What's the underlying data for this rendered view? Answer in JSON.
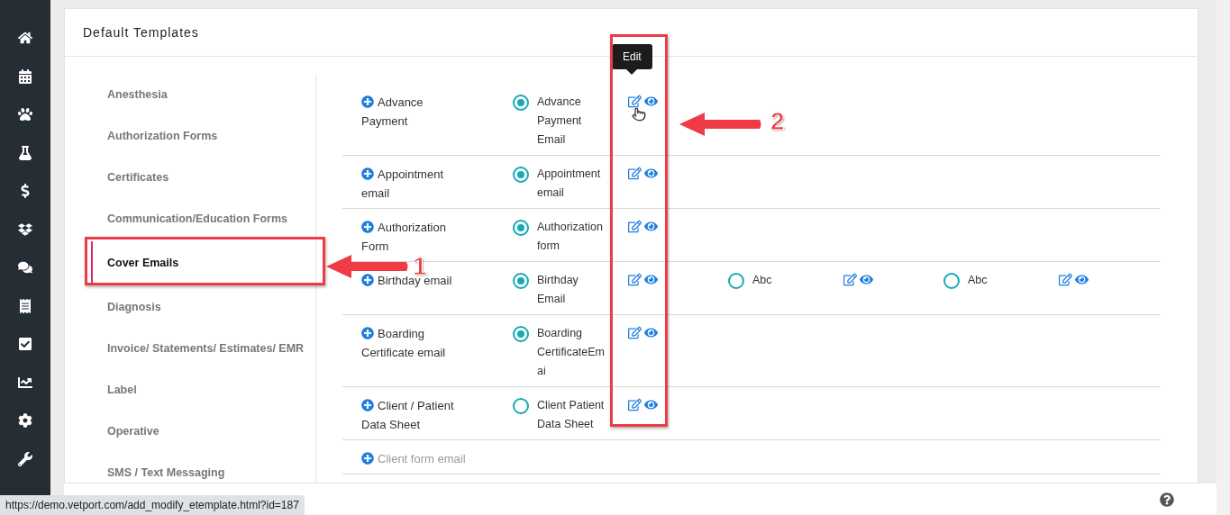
{
  "card": {
    "title": "Default Templates"
  },
  "menu": [
    {
      "label": "Anesthesia",
      "selected": false
    },
    {
      "label": "Authorization Forms",
      "selected": false
    },
    {
      "label": "Certificates",
      "selected": false
    },
    {
      "label": "Communication/Education Forms",
      "selected": false
    },
    {
      "label": "Cover Emails",
      "selected": true
    },
    {
      "label": "Diagnosis",
      "selected": false
    },
    {
      "label": "Invoice/ Statements/ Estimates/ EMR",
      "selected": false
    },
    {
      "label": "Label",
      "selected": false
    },
    {
      "label": "Operative",
      "selected": false
    },
    {
      "label": "SMS / Text Messaging",
      "selected": false
    }
  ],
  "rows": [
    {
      "name": "Advance Payment",
      "has_templates": true,
      "templates": [
        {
          "label": "Advance Payment Email",
          "selected": true
        }
      ]
    },
    {
      "name": "Appointment email",
      "has_templates": true,
      "templates": [
        {
          "label": "Appointment email",
          "selected": true
        }
      ]
    },
    {
      "name": "Authorization Form",
      "has_templates": true,
      "templates": [
        {
          "label": "Authorization form",
          "selected": true
        }
      ]
    },
    {
      "name": "Birthday email",
      "has_templates": true,
      "templates": [
        {
          "label": "Birthday Email",
          "selected": true
        },
        {
          "label": "Abc",
          "selected": false
        },
        {
          "label": "Abc",
          "selected": false
        }
      ]
    },
    {
      "name": "Boarding Certificate email",
      "has_templates": true,
      "templates": [
        {
          "label": "Boarding CertificateEmai",
          "selected": true
        }
      ]
    },
    {
      "name": "Client / Patient Data Sheet",
      "has_templates": true,
      "templates": [
        {
          "label": "Client Patient Data Sheet",
          "selected": false
        }
      ]
    },
    {
      "name": "Client form email",
      "has_templates": false
    }
  ],
  "tooltip": {
    "text": "Edit"
  },
  "annotations": [
    {
      "number": "1"
    },
    {
      "number": "2"
    }
  ],
  "status_url": "https://demo.vetport.com/add_modify_etemplate.html?id=187"
}
